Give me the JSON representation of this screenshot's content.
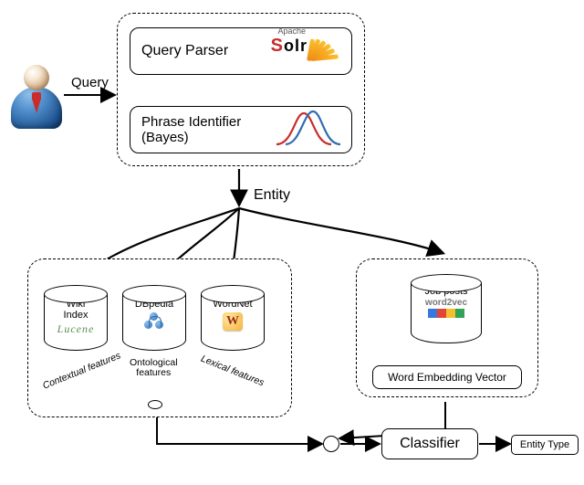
{
  "labels": {
    "query": "Query",
    "entity": "Entity",
    "entity_type": "Entity Type"
  },
  "top_group": {
    "query_parser": {
      "title": "Query Parser",
      "logo_apache": "Apache",
      "logo_main": "Solr"
    },
    "phrase_identifier": {
      "title_line1": "Phrase Identifier",
      "title_line2": "(Bayes)"
    }
  },
  "left_group": {
    "wiki": {
      "caption_l1": "Wiki",
      "caption_l2": "Index",
      "tool": "Lucene"
    },
    "dbpedia": {
      "caption": "DBpedia"
    },
    "wordnet": {
      "caption": "WordNet"
    },
    "feat_contextual": "Contextual features",
    "feat_ontological_l1": "Ontological",
    "feat_ontological_l2": "features",
    "feat_lexical": "Lexical features"
  },
  "right_group": {
    "jobposts": {
      "caption": "Job posts",
      "tool": "word2vec"
    },
    "embedding_box": "Word Embedding Vector"
  },
  "classifier": "Classifier"
}
